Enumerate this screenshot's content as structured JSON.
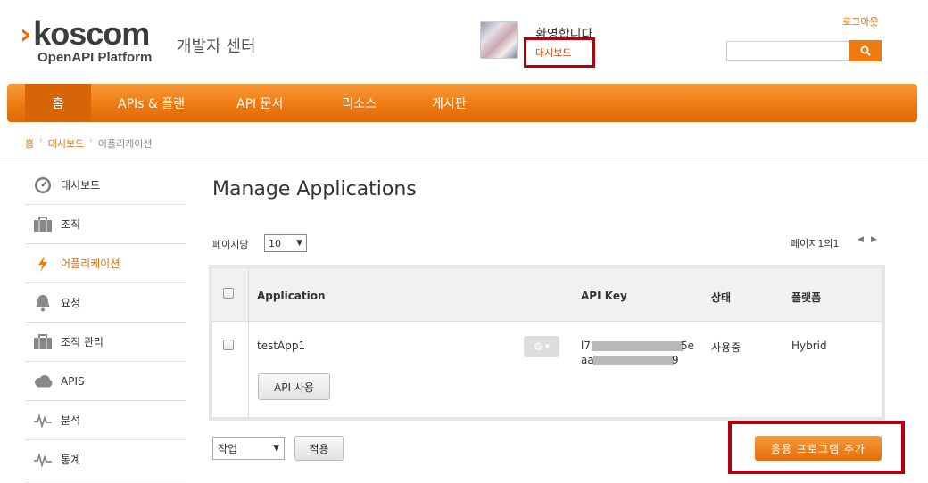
{
  "header": {
    "logo_word": "koscom",
    "logo_sub": "OpenAPI Platform",
    "dev_center": "개발자 센터",
    "welcome": "환영합니다",
    "dashboard_link": "대시보드",
    "logout": "로그아웃",
    "search_placeholder": ""
  },
  "nav": {
    "items": [
      {
        "label": "홈"
      },
      {
        "label": "APIs & 플랜"
      },
      {
        "label": "API 문서"
      },
      {
        "label": "리소스"
      },
      {
        "label": "게시판"
      }
    ]
  },
  "breadcrumb": {
    "home": "홈",
    "dashboard": "대시보드",
    "current": "어플리케이션"
  },
  "sidebar": {
    "items": [
      {
        "label": "대시보드",
        "icon": "dashboard-icon"
      },
      {
        "label": "조직",
        "icon": "briefcase-icon"
      },
      {
        "label": "어플리케이션",
        "icon": "lightning-icon"
      },
      {
        "label": "요청",
        "icon": "bell-icon"
      },
      {
        "label": "조직 관리",
        "icon": "briefcase-icon"
      },
      {
        "label": "APIS",
        "icon": "cloud-icon"
      },
      {
        "label": "분석",
        "icon": "pulse-icon"
      },
      {
        "label": "통계",
        "icon": "pulse-icon"
      }
    ]
  },
  "main": {
    "title": "Manage Applications",
    "per_page_label": "페이지당",
    "per_page_value": "10",
    "page_info": "페이지1의1",
    "table": {
      "headers": {
        "application": "Application",
        "api_key": "API Key",
        "status": "상태",
        "platform": "플랫폼"
      },
      "rows": [
        {
          "application": "testApp1",
          "api_key_line1_start": "l7",
          "api_key_line1_end": "5e",
          "api_key_line2_start": "aa",
          "api_key_line2_end": "9",
          "status": "사용중",
          "platform": "Hybrid",
          "api_use_button": "API 사용"
        }
      ]
    },
    "action_select_value": "작업",
    "apply_button": "적용",
    "add_app_button": "응용 프로그램 추가"
  },
  "colors": {
    "accent": "#f07a10",
    "highlight_box": "#b3000e",
    "link": "#e0700a"
  }
}
